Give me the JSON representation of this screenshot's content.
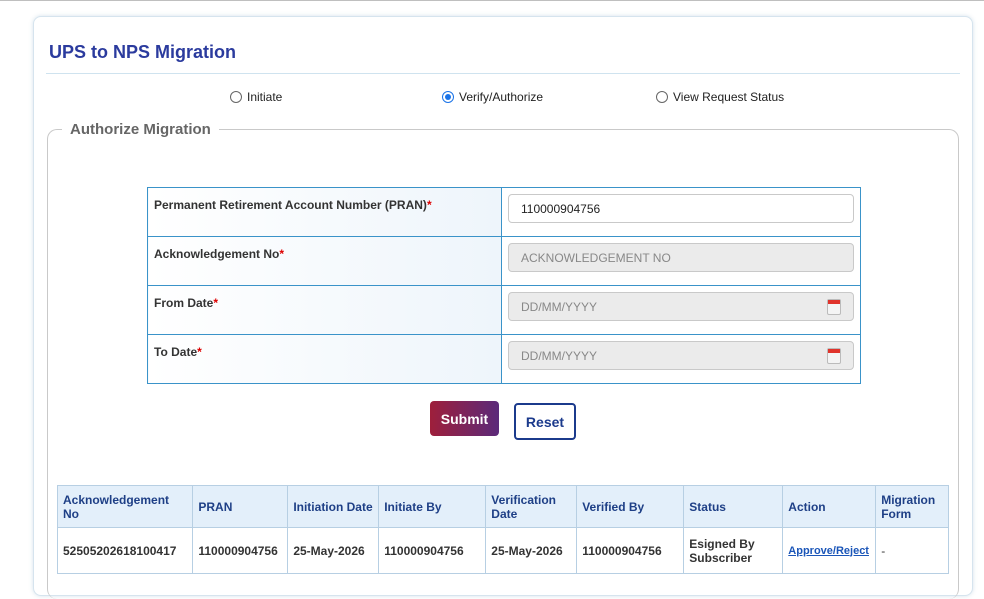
{
  "page": {
    "title": "UPS to NPS Migration"
  },
  "mode_options": [
    {
      "label": "Initiate",
      "checked": false
    },
    {
      "label": "Verify/Authorize",
      "checked": true
    },
    {
      "label": "View Request Status",
      "checked": false
    }
  ],
  "section": {
    "legend": "Authorize Migration"
  },
  "form": {
    "pran_label": "Permanent Retirement Account Number (PRAN)",
    "pran_value": "110000904756",
    "ack_label": "Acknowledgement No",
    "ack_placeholder": "ACKNOWLEDGEMENT NO",
    "from_label": "From Date",
    "from_placeholder": "DD/MM/YYYY",
    "to_label": "To Date",
    "to_placeholder": "DD/MM/YYYY",
    "required_mark": "*"
  },
  "buttons": {
    "submit": "Submit",
    "reset": "Reset"
  },
  "results": {
    "columns": [
      "Acknowledgement No",
      "PRAN",
      "Initiation Date",
      "Initiate By",
      "Verification Date",
      "Verified By",
      "Status",
      "Action",
      "Migration Form"
    ],
    "rows": [
      {
        "ack_no": "52505202618100417",
        "pran": "110000904756",
        "initiation_date": "25-May-2026",
        "initiate_by": "110000904756",
        "verification_date": "25-May-2026",
        "verified_by": "110000904756",
        "status": "Esigned By Subscriber",
        "action": "Approve/Reject",
        "migration_form": "-"
      }
    ]
  },
  "colors": {
    "title": "#2b3b9e",
    "accent_border": "#3a93c9",
    "submit_start": "#9e1f3b",
    "submit_end": "#5b2a7a"
  }
}
